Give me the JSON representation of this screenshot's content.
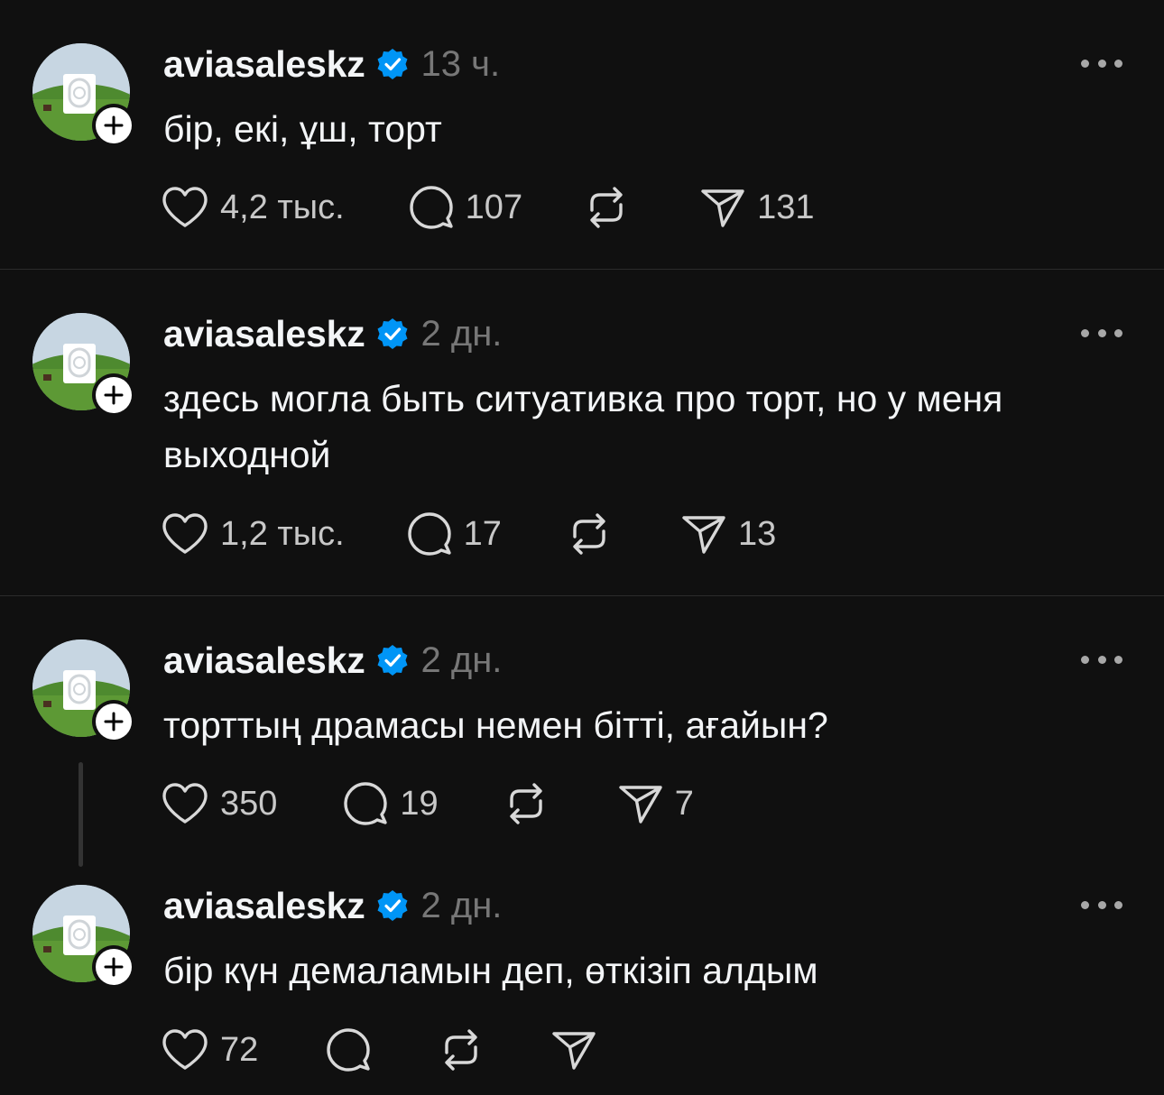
{
  "posts": [
    {
      "username": "aviasaleskz",
      "time": "13 ч.",
      "text": "бір, екі, ұш, торт",
      "likes": "4,2 тыс.",
      "comments": "107",
      "shares": "131"
    },
    {
      "username": "aviasaleskz",
      "time": "2 дн.",
      "text": "здесь могла быть ситуативка про торт, но у меня выходной",
      "likes": "1,2 тыс.",
      "comments": "17",
      "shares": "13"
    },
    {
      "username": "aviasaleskz",
      "time": "2 дн.",
      "text": "торттың драмасы немен бітті, ағайын?",
      "likes": "350",
      "comments": "19",
      "shares": "7"
    },
    {
      "username": "aviasaleskz",
      "time": "2 дн.",
      "text": "бір күн демаламын деп, өткізіп алдым",
      "likes": "72",
      "comments": "",
      "shares": ""
    }
  ],
  "icons": {
    "verified": "verified-badge-icon",
    "more": "more-horizontal-icon",
    "like": "heart-icon",
    "comment": "comment-icon",
    "repost": "repost-icon",
    "share": "send-icon",
    "follow": "plus-icon"
  },
  "colors": {
    "background": "#101010",
    "verified": "#0095f6",
    "muted": "#777777",
    "text": "#f3f5f7"
  }
}
